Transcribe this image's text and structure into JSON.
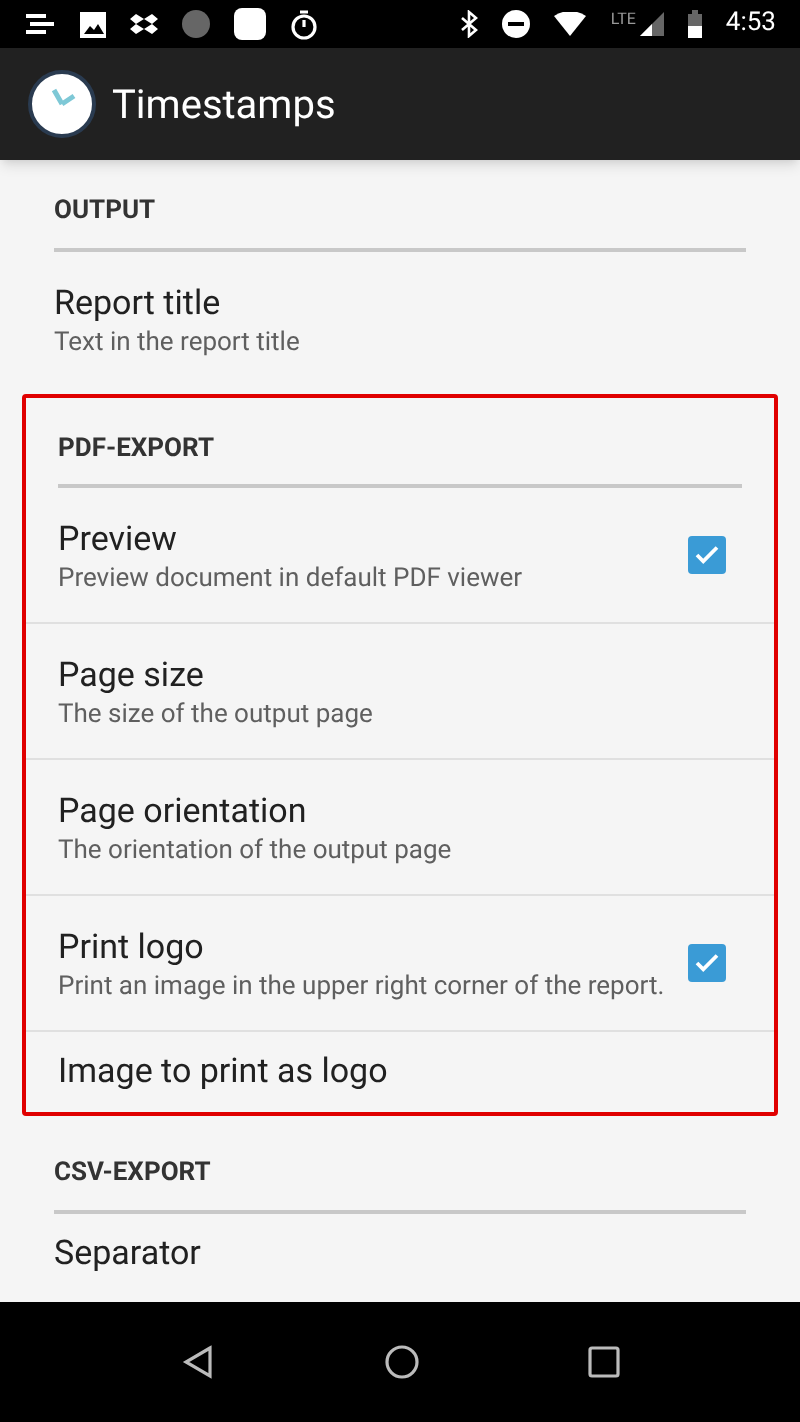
{
  "status_bar": {
    "time": "4:53",
    "network": "LTE"
  },
  "app_bar": {
    "title": "Timestamps"
  },
  "sections": [
    {
      "header": "OUTPUT",
      "highlighted": false,
      "items": [
        {
          "kind": "plain",
          "title": "Report title",
          "summary": "Text in the report title"
        }
      ]
    },
    {
      "header": "PDF-EXPORT",
      "highlighted": true,
      "items": [
        {
          "kind": "checkbox",
          "title": "Preview",
          "summary": "Preview document in default PDF viewer",
          "checked": true
        },
        {
          "kind": "plain",
          "title": "Page size",
          "summary": "The size of the output page"
        },
        {
          "kind": "plain",
          "title": "Page orientation",
          "summary": "The orientation of the output page"
        },
        {
          "kind": "checkbox",
          "title": "Print logo",
          "summary": "Print an image in the upper right corner of the report.",
          "checked": true
        },
        {
          "kind": "plain",
          "title": "Image to print as logo"
        }
      ]
    },
    {
      "header": "CSV-EXPORT",
      "highlighted": false,
      "items": [
        {
          "kind": "plain",
          "title": "Separator"
        }
      ]
    }
  ]
}
